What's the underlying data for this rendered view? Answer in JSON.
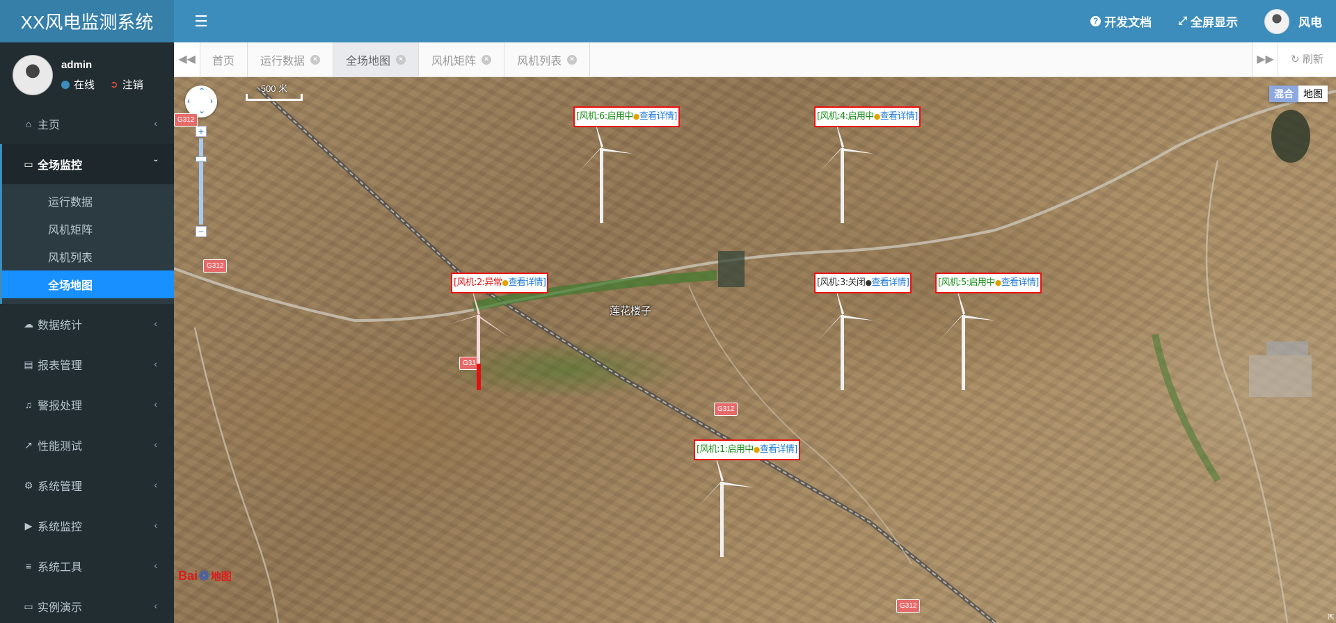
{
  "app": {
    "title": "XX风电监测系统"
  },
  "header": {
    "toggle_icon": "hamburger-icon",
    "docs_label": "开发文档",
    "fullscreen_label": "全屏显示",
    "user_name": "风电"
  },
  "sidebar": {
    "user": {
      "name": "admin",
      "status": "在线",
      "logout": "注销"
    },
    "menu": [
      {
        "label": "主页",
        "icon": "home-icon"
      },
      {
        "label": "全场监控",
        "icon": "monitor-icon",
        "expanded": true,
        "children": [
          "运行数据",
          "风机矩阵",
          "风机列表",
          "全场地图"
        ],
        "active_child": "全场地图"
      },
      {
        "label": "数据统计",
        "icon": "cloud-icon"
      },
      {
        "label": "报表管理",
        "icon": "file-icon"
      },
      {
        "label": "警报处理",
        "icon": "bell-icon"
      },
      {
        "label": "性能测试",
        "icon": "chart-icon"
      },
      {
        "label": "系统管理",
        "icon": "gear-icon"
      },
      {
        "label": "系统监控",
        "icon": "video-icon"
      },
      {
        "label": "系统工具",
        "icon": "list-icon"
      },
      {
        "label": "实例演示",
        "icon": "desktop-icon"
      }
    ]
  },
  "tabs": {
    "items": [
      "首页",
      "运行数据",
      "全场地图",
      "风机矩阵",
      "风机列表"
    ],
    "active": "全场地图",
    "refresh": "刷新"
  },
  "map": {
    "scale": "500 米",
    "type_hybrid": "混合",
    "type_map": "地图",
    "town": "莲花楼子",
    "road_labels": [
      "G312",
      "G312",
      "G312",
      "G312",
      "G31"
    ],
    "logo_text": "Bai",
    "logo_text2": "地图",
    "markers": [
      {
        "label": "[风机:6:启用中",
        "link": "查看详情]",
        "status_color": "#1a8f1a"
      },
      {
        "label": "[风机:4:启用中",
        "link": "查看详情]",
        "status_color": "#1a8f1a"
      },
      {
        "label": "[风机:2:异常",
        "link": "查看详情]",
        "status_color": "#e11111"
      },
      {
        "label": "[风机:3:关闭",
        "link": "查看详情]",
        "status_color": "#333333"
      },
      {
        "label": "[风机:5:启用中",
        "link": "查看详情]",
        "status_color": "#1a8f1a"
      },
      {
        "label": "[风机:1:启用中",
        "link": "查看详情]",
        "status_color": "#1a8f1a"
      }
    ]
  },
  "colors": {
    "header": "#3c8dbc",
    "logo_bg": "#367fa9",
    "sidebar": "#222d32",
    "active_sub": "#1890ff",
    "alarm": "#e11111"
  }
}
